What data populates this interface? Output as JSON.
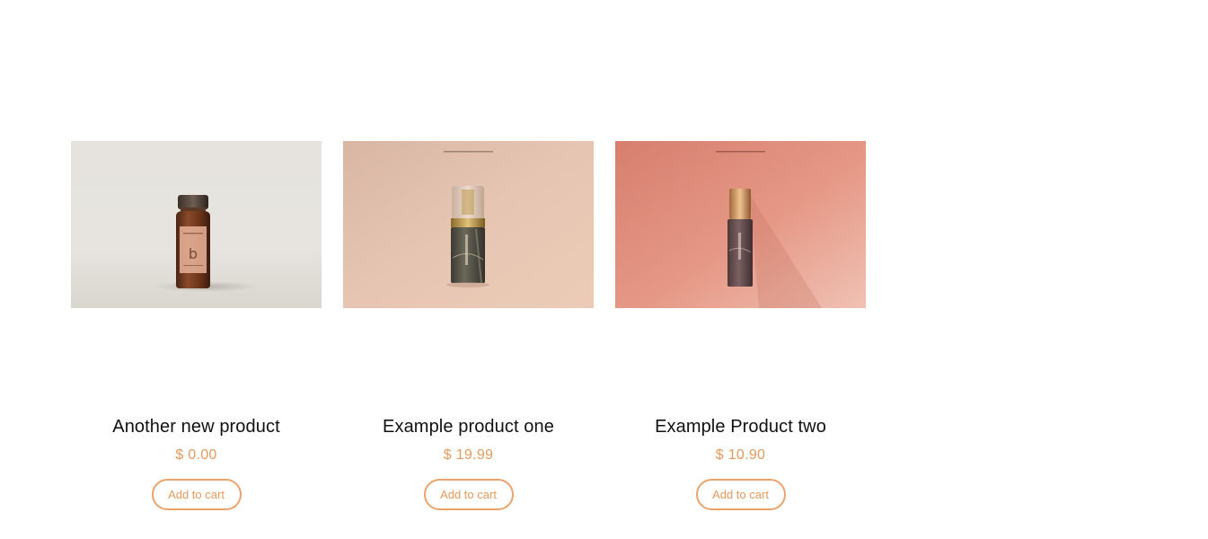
{
  "products": [
    {
      "title": "Another new product",
      "price": "$ 0.00",
      "cta": "Add to cart",
      "image_icon": "amber-vial-product-image"
    },
    {
      "title": "Example product one",
      "price": "$ 19.99",
      "cta": "Add to cart",
      "image_icon": "pump-bottle-product-image"
    },
    {
      "title": "Example Product two",
      "price": "$ 10.90",
      "cta": "Add to cart",
      "image_icon": "roller-bottle-product-image"
    }
  ],
  "colors": {
    "accent": "#e29a5e",
    "button_border": "#e9a36d",
    "title": "#111111",
    "background": "#ffffff"
  }
}
